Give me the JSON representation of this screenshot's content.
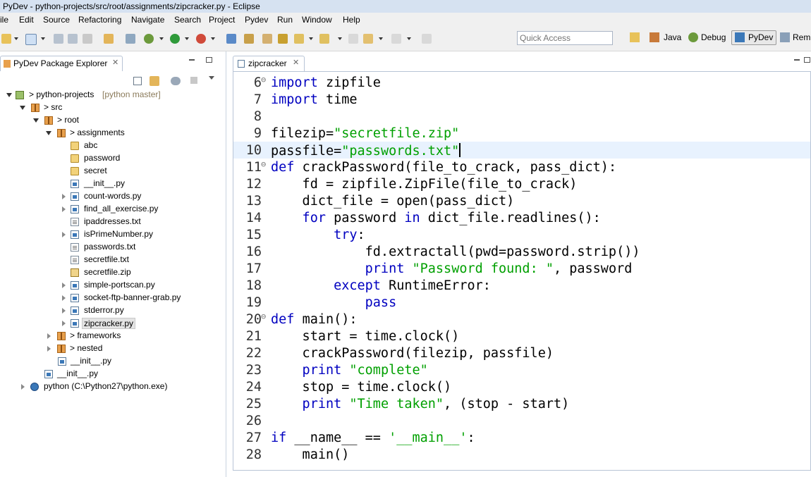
{
  "window": {
    "title": "PyDev - python-projects/src/root/assignments/zipcracker.py - Eclipse"
  },
  "menu": [
    "ile",
    "Edit",
    "Source",
    "Refactoring",
    "Navigate",
    "Search",
    "Project",
    "Pydev",
    "Run",
    "Window",
    "Help"
  ],
  "toolbar": {
    "quick_access_placeholder": "Quick Access",
    "perspectives": [
      "Java",
      "Debug",
      "PyDev",
      "Rem"
    ]
  },
  "explorer": {
    "tab_label": "PyDev Package Explorer",
    "tree": [
      {
        "label": "> python-projects",
        "decoration": "[python master]"
      },
      {
        "label": "> src"
      },
      {
        "label": "> root"
      },
      {
        "label": "> assignments"
      },
      {
        "label": "abc"
      },
      {
        "label": "password"
      },
      {
        "label": "secret"
      },
      {
        "label": "__init__.py"
      },
      {
        "label": "count-words.py"
      },
      {
        "label": "find_all_exercise.py"
      },
      {
        "label": "ipaddresses.txt"
      },
      {
        "label": "isPrimeNumber.py"
      },
      {
        "label": "passwords.txt"
      },
      {
        "label": "secretfile.txt"
      },
      {
        "label": "secretfile.zip"
      },
      {
        "label": "simple-portscan.py"
      },
      {
        "label": "socket-ftp-banner-grab.py"
      },
      {
        "label": "stderror.py"
      },
      {
        "label": "zipcracker.py"
      },
      {
        "label": "> frameworks"
      },
      {
        "label": "> nested"
      },
      {
        "label": "__init__.py"
      },
      {
        "label": "__init__.py"
      },
      {
        "label": "python  (C:\\Python27\\python.exe)"
      }
    ]
  },
  "editor": {
    "tab_label": "zipcracker",
    "lines": [
      {
        "num": "6",
        "fold": "⊖",
        "tokens": [
          [
            "kw",
            "import"
          ],
          [
            "",
            "zipfile"
          ]
        ]
      },
      {
        "num": "7",
        "fold": "",
        "tokens": [
          [
            "kw",
            "import"
          ],
          [
            "",
            "time"
          ]
        ]
      },
      {
        "num": "8",
        "fold": "",
        "tokens": []
      },
      {
        "num": "9",
        "fold": "",
        "tokens": [
          [
            "",
            "filezip="
          ],
          [
            "str",
            "\"secretfile.zip\""
          ]
        ]
      },
      {
        "num": "10",
        "fold": "",
        "tokens": [
          [
            "",
            "passfile="
          ],
          [
            "str",
            "\"passwords.txt\""
          ]
        ]
      },
      {
        "num": "11",
        "fold": "⊖",
        "tokens": [
          [
            "kw",
            "def"
          ],
          [
            "",
            "crackPassword(file_to_crack, pass_dict):"
          ]
        ]
      },
      {
        "num": "12",
        "fold": "",
        "tokens": [
          [
            "",
            "    fd = zipfile.ZipFile(file_to_crack)"
          ]
        ]
      },
      {
        "num": "13",
        "fold": "",
        "tokens": [
          [
            "",
            "    dict_file = open(pass_dict)"
          ]
        ]
      },
      {
        "num": "14",
        "fold": "",
        "tokens": [
          [
            "kw",
            "    for"
          ],
          [
            "",
            "password"
          ],
          [
            "kw",
            "in"
          ],
          [
            "",
            "dict_file.readlines():"
          ]
        ]
      },
      {
        "num": "15",
        "fold": "",
        "tokens": [
          [
            "kw",
            "        try"
          ],
          [
            "",
            ":"
          ]
        ]
      },
      {
        "num": "16",
        "fold": "",
        "tokens": [
          [
            "",
            "            fd.extractall(pwd=password.strip())"
          ]
        ]
      },
      {
        "num": "17",
        "fold": "",
        "tokens": [
          [
            "kw",
            "            print"
          ],
          [
            "str",
            "\"Password found: \""
          ],
          [
            "",
            ", password"
          ]
        ]
      },
      {
        "num": "18",
        "fold": "",
        "tokens": [
          [
            "kw",
            "        except"
          ],
          [
            "",
            "RuntimeError:"
          ]
        ]
      },
      {
        "num": "19",
        "fold": "",
        "tokens": [
          [
            "kw",
            "            pass"
          ]
        ]
      },
      {
        "num": "20",
        "fold": "⊖",
        "tokens": [
          [
            "kw",
            "def"
          ],
          [
            "",
            "main():"
          ]
        ]
      },
      {
        "num": "21",
        "fold": "",
        "tokens": [
          [
            "",
            "    start = time.clock()"
          ]
        ]
      },
      {
        "num": "22",
        "fold": "",
        "tokens": [
          [
            "",
            "    crackPassword(filezip, passfile)"
          ]
        ]
      },
      {
        "num": "23",
        "fold": "",
        "tokens": [
          [
            "kw",
            "    print"
          ],
          [
            "str",
            "\"complete\""
          ]
        ]
      },
      {
        "num": "24",
        "fold": "",
        "tokens": [
          [
            "",
            "    stop = time.clock()"
          ]
        ]
      },
      {
        "num": "25",
        "fold": "",
        "tokens": [
          [
            "kw",
            "    print"
          ],
          [
            "str",
            "\"Time taken\""
          ],
          [
            "",
            ", (stop - start)"
          ]
        ]
      },
      {
        "num": "26",
        "fold": "",
        "tokens": []
      },
      {
        "num": "27",
        "fold": "",
        "tokens": [
          [
            "kw",
            "if"
          ],
          [
            "",
            "__name__ =="
          ],
          [
            "str",
            "'__main__'"
          ],
          [
            "",
            ":"
          ]
        ]
      },
      {
        "num": "28",
        "fold": "",
        "tokens": [
          [
            "",
            "    main()"
          ]
        ]
      }
    ]
  }
}
